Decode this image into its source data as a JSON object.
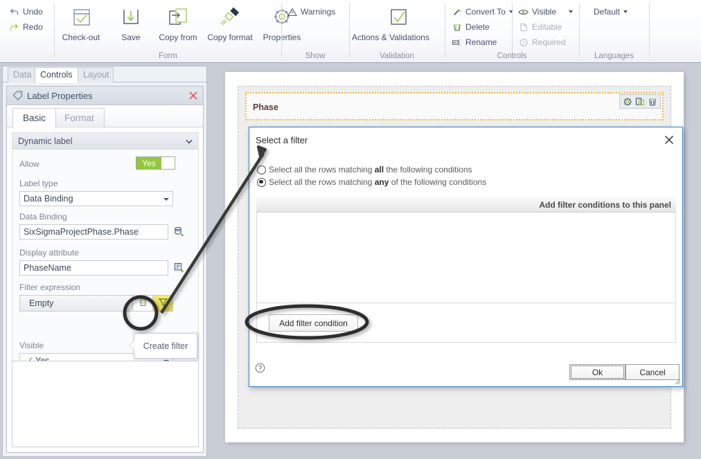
{
  "ribbon": {
    "quick": [
      {
        "label": "Undo",
        "icon": "undo-icon"
      },
      {
        "label": "Redo",
        "icon": "redo-icon"
      }
    ],
    "groups": [
      {
        "caption": "Form",
        "buttons": [
          {
            "label": "Check-out",
            "icon": "checkout-icon"
          },
          {
            "label": "Save",
            "icon": "save-icon"
          },
          {
            "label": "Copy from",
            "icon": "copy-from-icon"
          },
          {
            "label": "Copy format",
            "icon": "copy-format-icon"
          },
          {
            "label": "Properties",
            "icon": "properties-gear-icon"
          }
        ]
      },
      {
        "caption": "Show",
        "items": [
          {
            "label": "Warnings",
            "icon": "warning-triangle-icon"
          }
        ]
      },
      {
        "caption": "Validation",
        "buttons": [
          {
            "label": "Actions & Validations",
            "icon": "check-square-icon"
          }
        ]
      },
      {
        "caption": "Controls",
        "items": [
          {
            "label": "Convert To",
            "icon": "convert-to-icon",
            "dropdown": true,
            "disabled": false
          },
          {
            "label": "Delete",
            "icon": "delete-trash-icon",
            "disabled": false
          },
          {
            "label": "Rename",
            "icon": "rename-icon",
            "disabled": false
          },
          {
            "label": "Visible",
            "icon": "eye-icon",
            "dropdown": true,
            "disabled": false
          },
          {
            "label": "Editable",
            "icon": "editable-page-icon",
            "disabled": true
          },
          {
            "label": "Required",
            "icon": "required-exclaim-icon",
            "disabled": true
          }
        ]
      },
      {
        "caption": "Languages",
        "items": [
          {
            "label": "Default",
            "icon": "",
            "dropdown": true
          }
        ]
      }
    ]
  },
  "left_panel": {
    "tabs": [
      {
        "label": "Data",
        "active": false
      },
      {
        "label": "Controls",
        "active": true
      },
      {
        "label": "Layout",
        "active": false
      }
    ],
    "properties": {
      "title": "Label Properties",
      "title_icon": "tag-icon",
      "close_icon": "close-icon",
      "subtabs": [
        {
          "label": "Basic",
          "active": true
        },
        {
          "label": "Format",
          "active": false
        }
      ],
      "section": {
        "name": "Dynamic label",
        "collapse_icon": "chevron-down-icon",
        "fields": {
          "allow_label": "Allow",
          "allow_value": "Yes",
          "label_type_label": "Label type",
          "label_type_value": "Data Binding",
          "data_binding_label": "Data Binding",
          "data_binding_value": "SixSigmaProjectPhase.Phase",
          "data_binding_icon": "database-add-icon",
          "display_attribute_label": "Display attribute",
          "display_attribute_value": "PhaseName",
          "display_attribute_icon": "attribute-add-icon",
          "filter_expression_label": "Filter expression",
          "filter_expression_value": "Empty",
          "filter_delete_icon": "trash-icon",
          "filter_create_icon": "funnel-icon",
          "visible_label": "Visible",
          "visible_value": "Yes",
          "visible_check_icon": "check-icon"
        }
      }
    },
    "tooltip": "Create filter"
  },
  "designer": {
    "control_name": "Phase",
    "control_tools": [
      {
        "icon": "gear-icon",
        "name": "control-settings"
      },
      {
        "icon": "duplicate-icon",
        "name": "control-duplicate"
      },
      {
        "icon": "trash-icon",
        "name": "control-delete"
      }
    ]
  },
  "modal": {
    "title": "Select a filter",
    "close_icon": "close-icon",
    "options": [
      {
        "pre": "Select all the rows matching ",
        "strong": "all",
        "post": " the following conditions",
        "selected": false
      },
      {
        "pre": "Select all the rows matching ",
        "strong": "any",
        "post": " of the following conditions",
        "selected": true
      }
    ],
    "panel_header": "Add filter conditions to this panel",
    "add_condition_label": "Add filter condition",
    "ok_label": "Ok",
    "cancel_label": "Cancel",
    "help_icon": "help-circle-icon",
    "resize_icon": "resize-grip-icon"
  },
  "colors": {
    "accent_green": "#93c83e",
    "filter_yellow": "#ecd84d",
    "modal_border": "#2b7cd3",
    "selection_orange": "#edb53c",
    "annotation_black": "#333333"
  }
}
